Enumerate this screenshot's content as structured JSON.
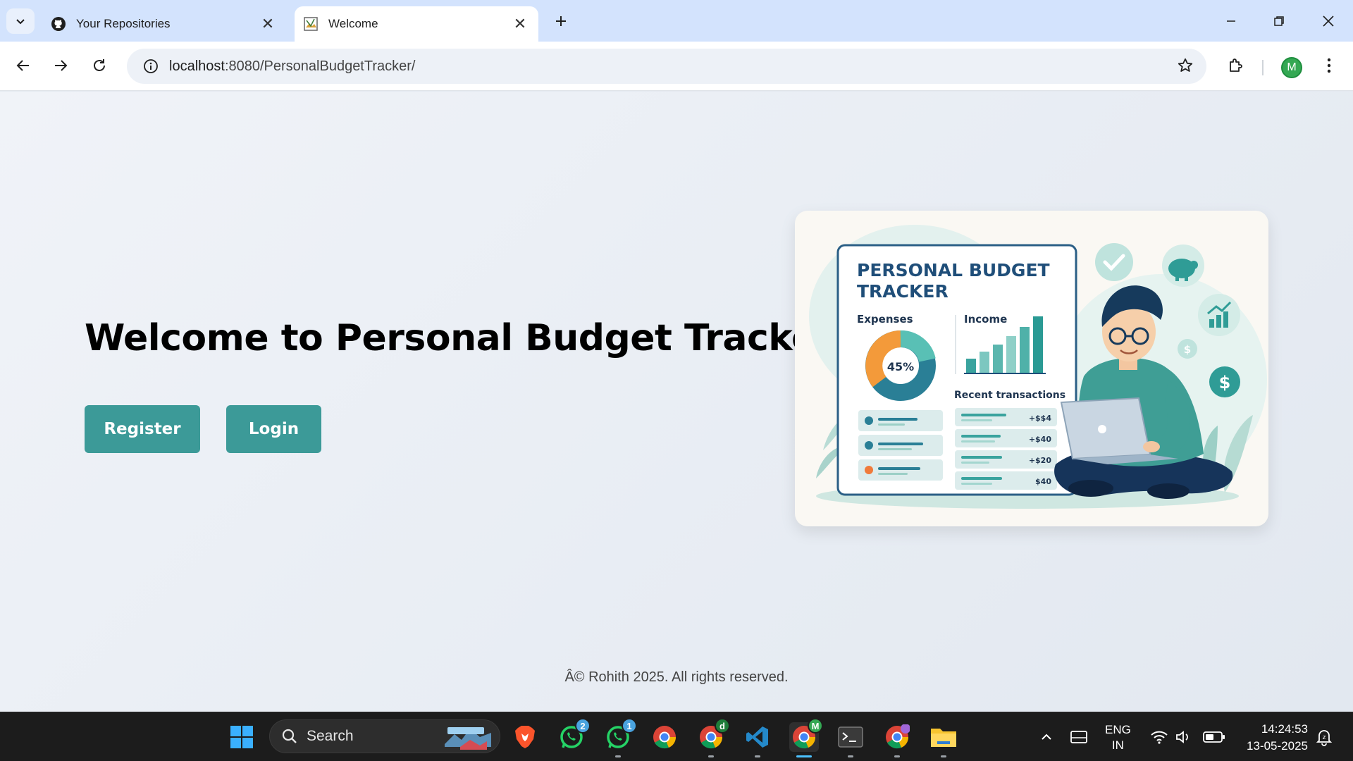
{
  "browser": {
    "tabs": [
      {
        "title": "Your Repositories",
        "favicon": "github-icon",
        "active": false
      },
      {
        "title": "Welcome",
        "favicon": "broken-image-icon",
        "active": true
      }
    ],
    "address": {
      "host": "localhost",
      "path": ":8080/PersonalBudgetTracker/"
    },
    "profile_initial": "M"
  },
  "page": {
    "headline": "Welcome to Personal Budget Tracker",
    "buttons": {
      "register": "Register",
      "login": "Login"
    },
    "illustration": {
      "title_line1": "PERSONAL BUDGET",
      "title_line2": "TRACKER",
      "expenses_label": "Expenses",
      "income_label": "Income",
      "donut_percent": "45%",
      "recent_label": "Recent transactions",
      "transactions": [
        "+$$4",
        "+$40",
        "+$20",
        "$40"
      ]
    },
    "footer": "Â© Rohith 2025. All rights reserved."
  },
  "taskbar": {
    "search_placeholder": "Search",
    "whatsapp_badge_1": "2",
    "whatsapp_badge_2": "1",
    "chrome_profile_badge": "d",
    "chrome_active_badge": "M",
    "language": "ENG",
    "region": "IN",
    "time": "14:24:53",
    "date": "13-05-2025"
  },
  "colors": {
    "accent": "#3c9a98",
    "tabstrip": "#d3e3fd",
    "taskbar": "#1c1c1c",
    "illus_navy": "#1f4e79",
    "illus_teal": "#3ba5a0",
    "illus_orange": "#f39a3a"
  }
}
